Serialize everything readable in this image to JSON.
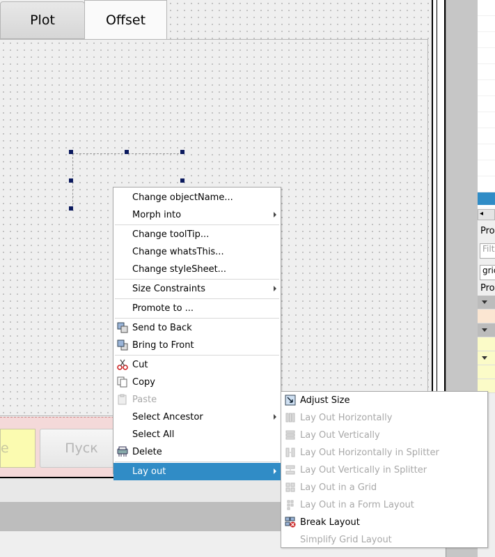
{
  "tabs": [
    {
      "label": "Plot"
    },
    {
      "label": "Offset"
    }
  ],
  "bottom": {
    "line_edit_text": "е",
    "start_button_label": "Пуск"
  },
  "right_panel": {
    "texts": [
      "Pro",
      "Filt",
      "grid",
      "Pro"
    ]
  },
  "context_menu": {
    "items": [
      {
        "label": "Change objectName..."
      },
      {
        "label": "Morph into"
      },
      {
        "label": "Change toolTip..."
      },
      {
        "label": "Change whatsThis..."
      },
      {
        "label": "Change styleSheet..."
      },
      {
        "label": "Size Constraints"
      },
      {
        "label": "Promote to ..."
      },
      {
        "label": "Send to Back"
      },
      {
        "label": "Bring to Front"
      },
      {
        "label": "Cut"
      },
      {
        "label": "Copy"
      },
      {
        "label": "Paste"
      },
      {
        "label": "Select Ancestor"
      },
      {
        "label": "Select All"
      },
      {
        "label": "Delete"
      },
      {
        "label": "Lay out"
      }
    ]
  },
  "submenu": {
    "items": [
      {
        "label": "Adjust Size"
      },
      {
        "label": "Lay Out Horizontally"
      },
      {
        "label": "Lay Out Vertically"
      },
      {
        "label": "Lay Out Horizontally in Splitter"
      },
      {
        "label": "Lay Out Vertically in Splitter"
      },
      {
        "label": "Lay Out in a Grid"
      },
      {
        "label": "Lay Out in a Form Layout"
      },
      {
        "label": "Break Layout"
      },
      {
        "label": "Simplify Grid Layout"
      }
    ]
  },
  "colors": {
    "accent": "#308cc6",
    "disabled_text": "#a8a8a8",
    "line_edit_bg": "#fbfbb0"
  }
}
